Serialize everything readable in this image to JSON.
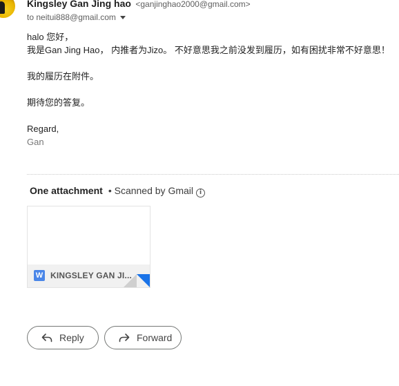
{
  "sender": {
    "name": "Kingsley Gan Jing hao",
    "email": "<ganjinghao2000@gmail.com>"
  },
  "recipient": {
    "to_text": "to neitui888@gmail.com"
  },
  "message": {
    "lines": [
      "halo 您好，",
      "我是Gan Jing Hao， 内推者为Jizo。 不好意思我之前没发到履历，如有困扰非常不好意思！",
      "我的履历在附件。",
      "期待您的答复。",
      "Regard,",
      "Gan"
    ]
  },
  "attachments": {
    "count_label": "One attachment",
    "scan_label": "• Scanned by Gmail",
    "info_symbol": "i",
    "file": {
      "type_icon": "W",
      "name": "KINGSLEY GAN JI..."
    }
  },
  "actions": {
    "reply_label": "Reply",
    "forward_label": "Forward"
  },
  "colors": {
    "word_icon": "#4a86e8",
    "fold_accent": "#1a73e8"
  }
}
